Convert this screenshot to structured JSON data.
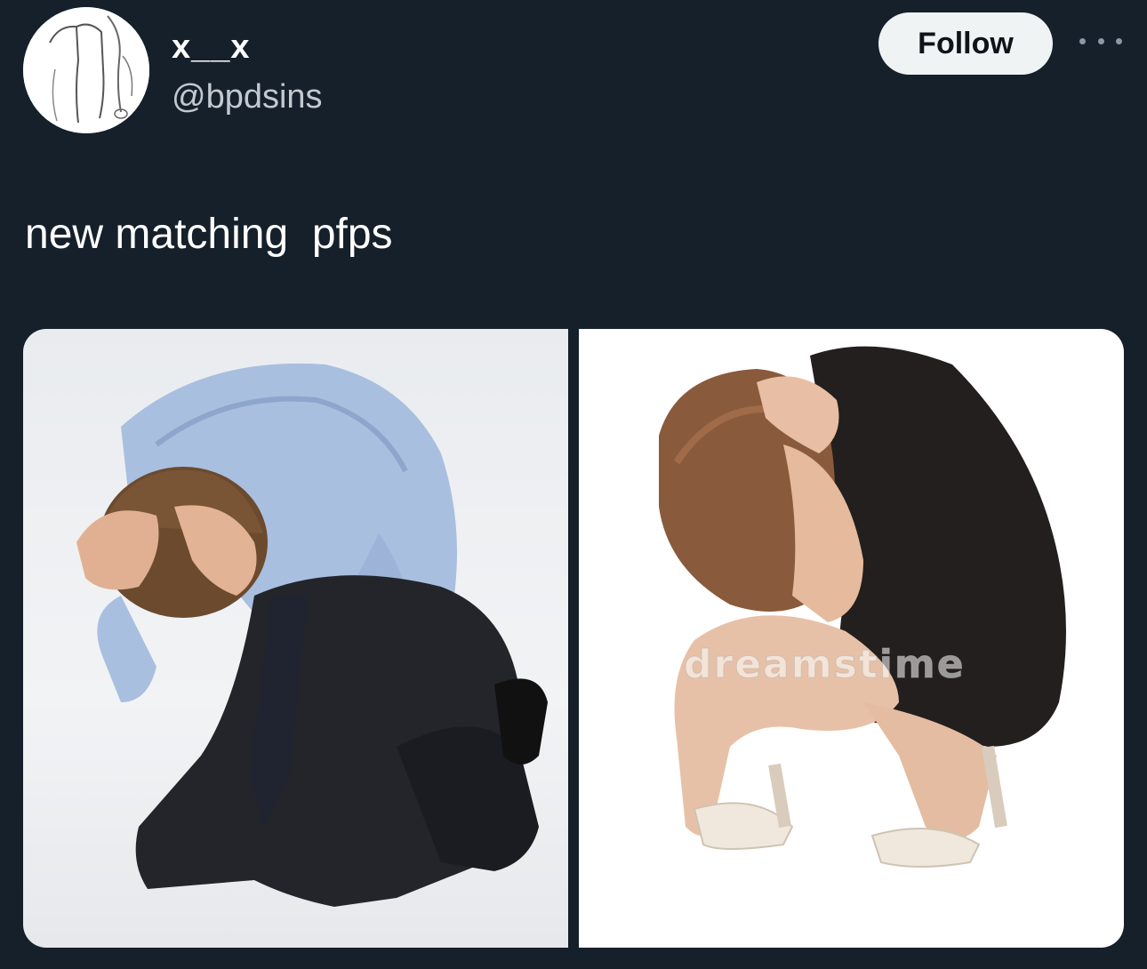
{
  "tweet": {
    "display_name": "x__x",
    "handle": "@bpdsins",
    "follow_label": "Follow",
    "text": "new matching  pfps"
  },
  "media": {
    "right_watermark": "dreamstime"
  },
  "icons": {
    "more": "more-horizontal-icon",
    "avatar": "avatar-sketch-image"
  },
  "colors": {
    "background": "#15202b",
    "follow_button_bg": "#eff3f4",
    "follow_button_text": "#0f1419",
    "handle_text": "#c3c9d0"
  }
}
